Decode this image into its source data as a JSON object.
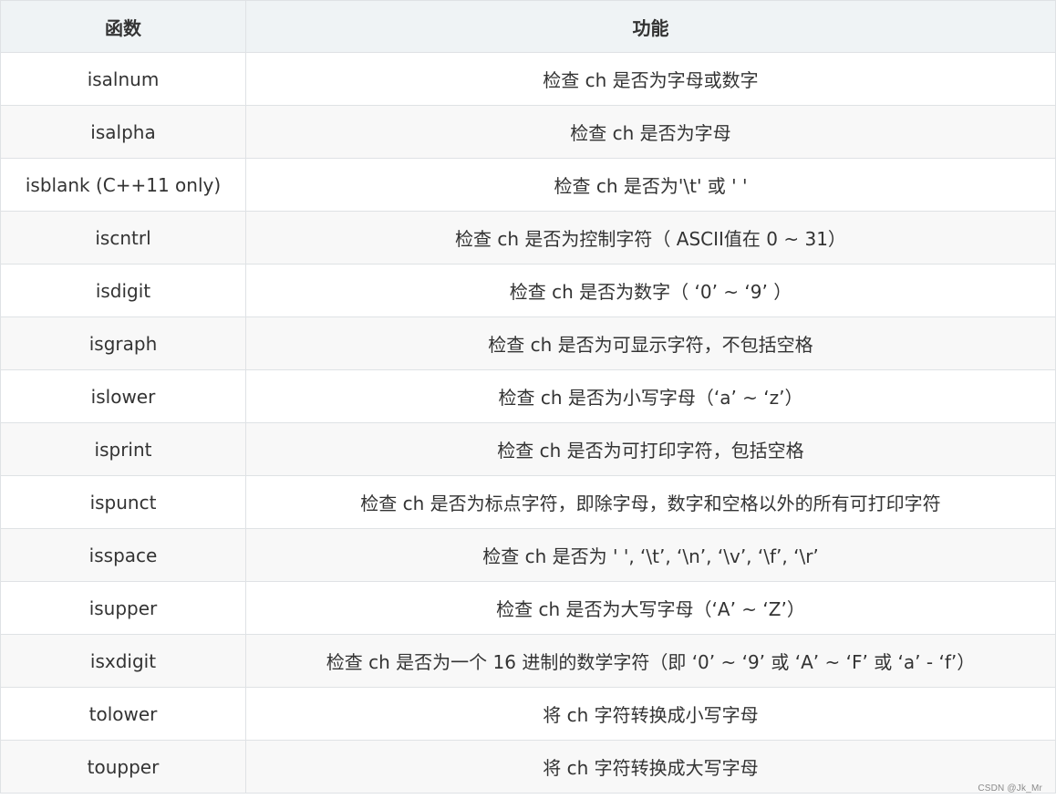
{
  "table": {
    "headers": [
      "函数",
      "功能"
    ],
    "rows": [
      {
        "func": "isalnum",
        "desc": "检查 ch 是否为字母或数字"
      },
      {
        "func": "isalpha",
        "desc": "检查 ch 是否为字母"
      },
      {
        "func": "isblank (C++11 only)",
        "desc": "检查 ch 是否为'\\t' 或 ' '"
      },
      {
        "func": "iscntrl",
        "desc": "检查 ch 是否为控制字符（ ASCII值在 0 ~ 31）"
      },
      {
        "func": "isdigit",
        "desc": "检查 ch 是否为数字（ ‘0’ ~ ‘9’ ）"
      },
      {
        "func": "isgraph",
        "desc": "检查 ch 是否为可显示字符，不包括空格"
      },
      {
        "func": "islower",
        "desc": "检查 ch 是否为小写字母（‘a’ ~ ‘z’）"
      },
      {
        "func": "isprint",
        "desc": "检查 ch 是否为可打印字符，包括空格"
      },
      {
        "func": "ispunct",
        "desc": "检查 ch 是否为标点字符，即除字母，数字和空格以外的所有可打印字符"
      },
      {
        "func": "isspace",
        "desc": "检查 ch 是否为 ' ', ‘\\t’, ‘\\n’, ‘\\v’, ‘\\f’, ‘\\r’"
      },
      {
        "func": "isupper",
        "desc": "检查 ch 是否为大写字母（‘A’ ~ ‘Z’）"
      },
      {
        "func": "isxdigit",
        "desc": "检查 ch 是否为一个 16 进制的数学字符（即 ‘0’ ~ ‘9’ 或 ‘A’ ~ ‘F’ 或 ‘a’ - ‘f’）"
      },
      {
        "func": "tolower",
        "desc": "将 ch 字符转换成小写字母"
      },
      {
        "func": "toupper",
        "desc": "将 ch 字符转换成大写字母"
      }
    ]
  },
  "watermark": "CSDN @Jk_Mr"
}
